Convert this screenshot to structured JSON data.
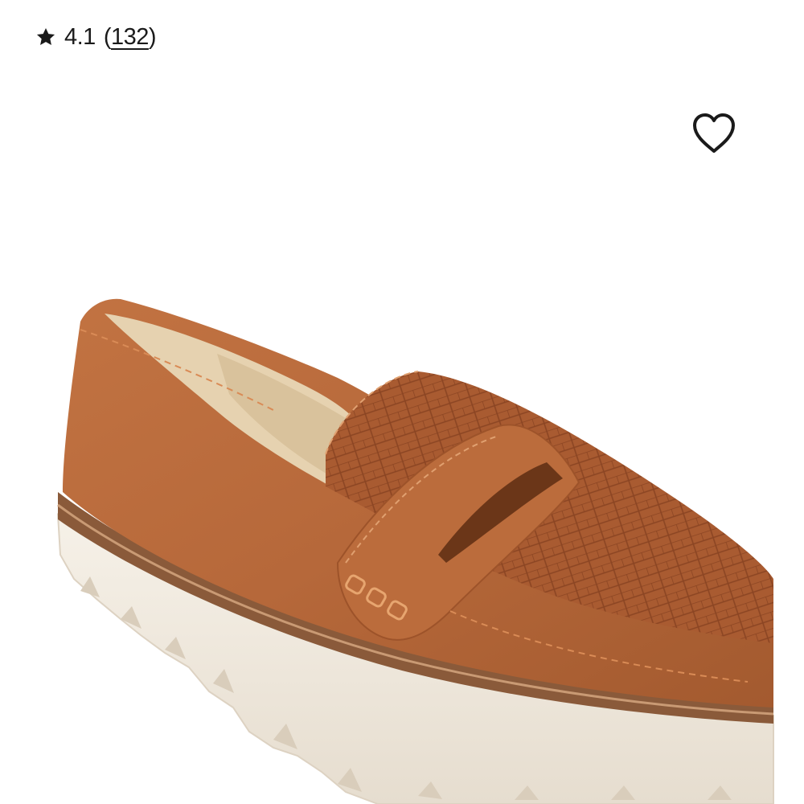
{
  "rating": {
    "score": "4.1",
    "open_paren": "(",
    "count": "132",
    "close_paren": ")",
    "star_icon": "star-icon"
  },
  "wishlist": {
    "icon": "heart-outline-icon"
  },
  "product_image": {
    "kind": "brown leather penny loafer with croc-embossed vamp on white lug sole",
    "colors": {
      "leather": "#b8693a",
      "croc": "#a85a30",
      "sole": "#f1ebe0",
      "welt": "#8a5a3a",
      "lining": "#e6d2b0"
    }
  }
}
